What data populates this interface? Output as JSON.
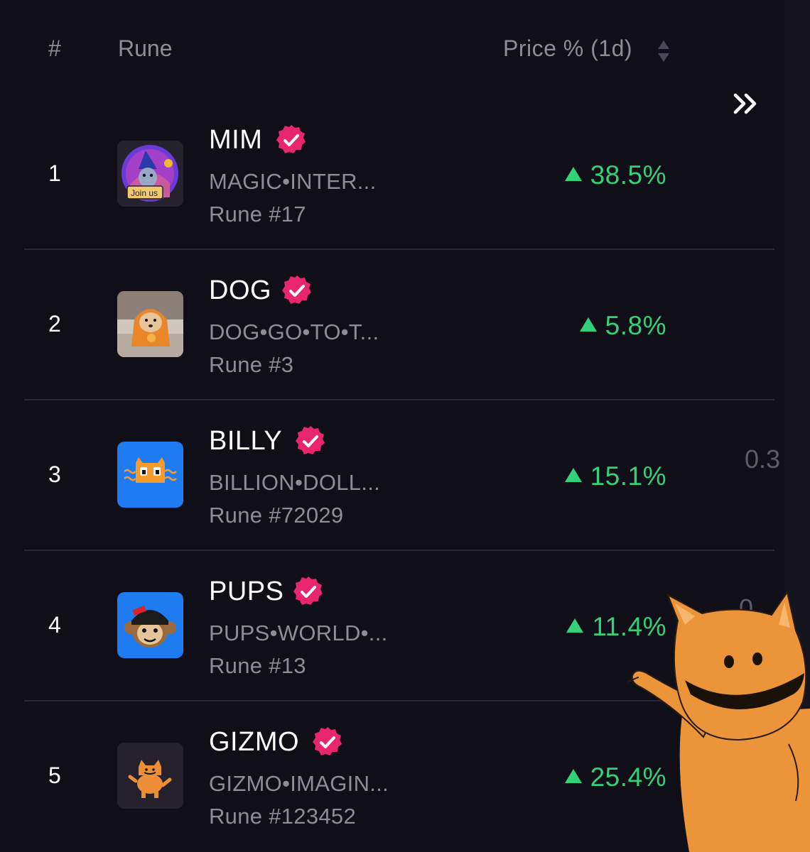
{
  "header": {
    "rank_col": "#",
    "rune_col": "Rune",
    "price_col": "Price % (1d)"
  },
  "icons": {
    "sort": "sort-updown-icon",
    "expand": "double-chevron-right-icon",
    "verified": "verified-badge-icon"
  },
  "colors": {
    "background": "#100e17",
    "muted_text": "#8f8c98",
    "positive": "#34d17a",
    "verified_badge": "#e8266e"
  },
  "rows": [
    {
      "rank": "1",
      "ticker": "MIM",
      "name": "MAGIC•INTER...",
      "rune_number": "Rune #17",
      "change": "38.5%",
      "trend": "up",
      "image": "wizard-cat-thumbnail",
      "clipped_value": ""
    },
    {
      "rank": "2",
      "ticker": "DOG",
      "name": "DOG•GO•TO•T...",
      "rune_number": "Rune #3",
      "change": "5.8%",
      "trend": "up",
      "image": "dog-in-orange-hoodie-thumbnail",
      "clipped_value": ""
    },
    {
      "rank": "3",
      "ticker": "BILLY",
      "name": "BILLION•DOLL...",
      "rune_number": "Rune #72029",
      "change": "15.1%",
      "trend": "up",
      "image": "orange-cat-face-thumbnail",
      "clipped_value": "0.3"
    },
    {
      "rank": "4",
      "ticker": "PUPS",
      "name": "PUPS•WORLD•...",
      "rune_number": "Rune #13",
      "change": "11.4%",
      "trend": "up",
      "image": "monkey-with-beanie-thumbnail",
      "clipped_value": "0"
    },
    {
      "rank": "5",
      "ticker": "GIZMO",
      "name": "GIZMO•IMAGIN...",
      "rune_number": "Rune #123452",
      "change": "25.4%",
      "trend": "up",
      "image": "orange-cat-thumbnail",
      "clipped_value": ""
    }
  ],
  "overlay": {
    "image": "pointing-orange-cat-sticker"
  }
}
